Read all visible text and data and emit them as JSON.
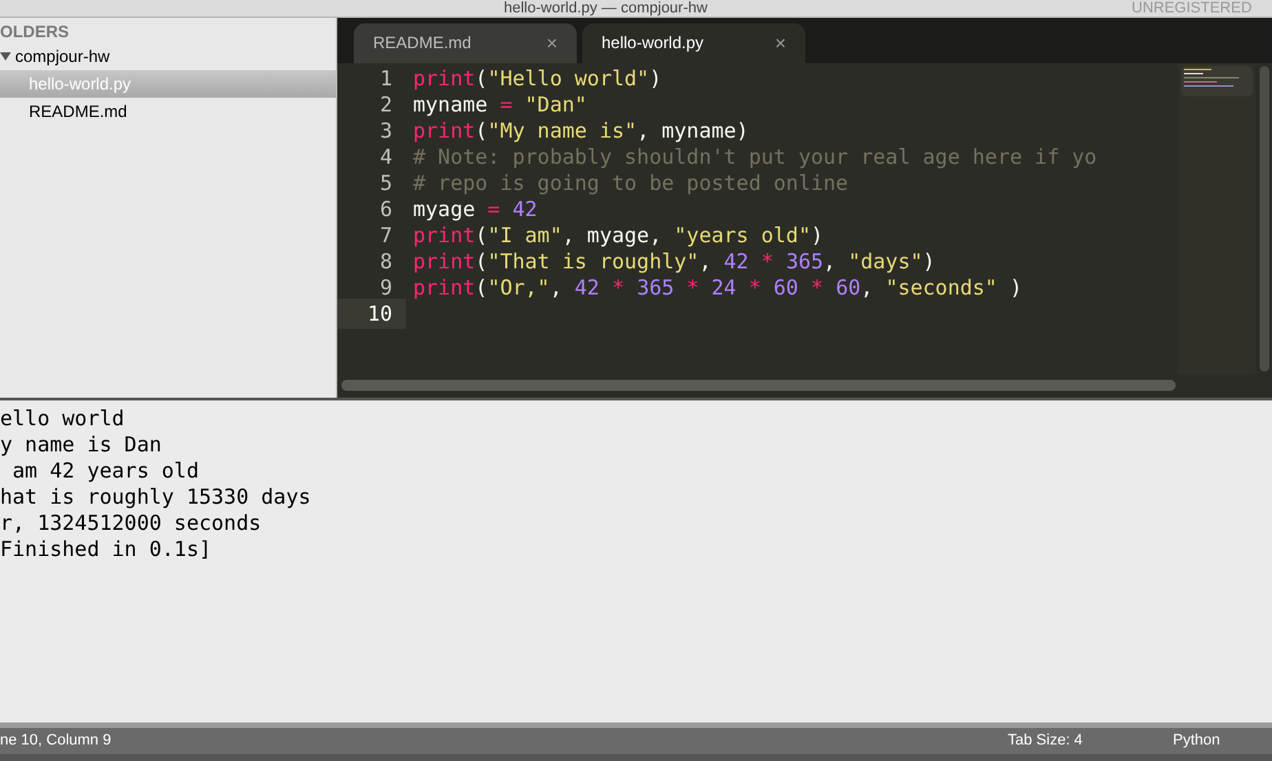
{
  "window": {
    "title": "hello-world.py — compjour-hw",
    "badge": "UNREGISTERED"
  },
  "sidebar": {
    "header": "OLDERS",
    "items": [
      {
        "label": "compjour-hw",
        "expanded": true,
        "selected": false,
        "children": [
          {
            "label": "hello-world.py",
            "selected": true
          },
          {
            "label": "README.md",
            "selected": false
          }
        ]
      }
    ]
  },
  "tabs": [
    {
      "label": "README.md",
      "close": "×",
      "selected": false
    },
    {
      "label": "hello-world.py",
      "close": "×",
      "selected": true
    }
  ],
  "editor": {
    "lines": [
      {
        "number": "1",
        "current": false,
        "tokens": [
          {
            "kind": "builtin",
            "text": "print"
          },
          {
            "kind": "plain",
            "text": "("
          },
          {
            "kind": "string",
            "text": "\"Hello world\""
          },
          {
            "kind": "plain",
            "text": ")"
          }
        ]
      },
      {
        "number": "2",
        "current": false,
        "tokens": [
          {
            "kind": "plain",
            "text": "myname"
          },
          {
            "kind": "operator",
            "text": " = "
          },
          {
            "kind": "string",
            "text": "\"Dan\""
          }
        ]
      },
      {
        "number": "3",
        "current": false,
        "tokens": [
          {
            "kind": "builtin",
            "text": "print"
          },
          {
            "kind": "plain",
            "text": "("
          },
          {
            "kind": "string",
            "text": "\"My name is\""
          },
          {
            "kind": "plain",
            "text": ", myname)"
          }
        ]
      },
      {
        "number": "4",
        "current": false,
        "tokens": [
          {
            "kind": "comment",
            "text": "# Note: probably shouldn't put your real age here if yo"
          }
        ]
      },
      {
        "number": "5",
        "current": false,
        "tokens": [
          {
            "kind": "comment",
            "text": "# repo is going to be posted online"
          }
        ]
      },
      {
        "number": "6",
        "current": false,
        "tokens": [
          {
            "kind": "plain",
            "text": "myage"
          },
          {
            "kind": "operator",
            "text": " = "
          },
          {
            "kind": "number",
            "text": "42"
          }
        ]
      },
      {
        "number": "7",
        "current": false,
        "tokens": [
          {
            "kind": "builtin",
            "text": "print"
          },
          {
            "kind": "plain",
            "text": "("
          },
          {
            "kind": "string",
            "text": "\"I am\""
          },
          {
            "kind": "plain",
            "text": ", myage, "
          },
          {
            "kind": "string",
            "text": "\"years old\""
          },
          {
            "kind": "plain",
            "text": ")"
          }
        ]
      },
      {
        "number": "8",
        "current": false,
        "tokens": [
          {
            "kind": "builtin",
            "text": "print"
          },
          {
            "kind": "plain",
            "text": "("
          },
          {
            "kind": "string",
            "text": "\"That is roughly\""
          },
          {
            "kind": "plain",
            "text": ", "
          },
          {
            "kind": "number",
            "text": "42"
          },
          {
            "kind": "operator",
            "text": " * "
          },
          {
            "kind": "number",
            "text": "365"
          },
          {
            "kind": "plain",
            "text": ", "
          },
          {
            "kind": "string",
            "text": "\"days\""
          },
          {
            "kind": "plain",
            "text": ")"
          }
        ]
      },
      {
        "number": "9",
        "current": false,
        "tokens": [
          {
            "kind": "builtin",
            "text": "print"
          },
          {
            "kind": "plain",
            "text": "("
          },
          {
            "kind": "string",
            "text": "\"Or,\""
          },
          {
            "kind": "plain",
            "text": ", "
          },
          {
            "kind": "number",
            "text": "42"
          },
          {
            "kind": "operator",
            "text": " * "
          },
          {
            "kind": "number",
            "text": "365"
          },
          {
            "kind": "operator",
            "text": " * "
          },
          {
            "kind": "number",
            "text": "24"
          },
          {
            "kind": "operator",
            "text": " * "
          },
          {
            "kind": "number",
            "text": "60"
          },
          {
            "kind": "operator",
            "text": " * "
          },
          {
            "kind": "number",
            "text": "60"
          },
          {
            "kind": "plain",
            "text": ", "
          },
          {
            "kind": "string",
            "text": "\"seconds\""
          },
          {
            "kind": "plain",
            "text": " )"
          }
        ]
      },
      {
        "number": "10",
        "current": true
      }
    ]
  },
  "output": {
    "lines": [
      "ello world",
      "y name is Dan",
      " am 42 years old",
      "hat is roughly 15330 days",
      "r, 1324512000 seconds",
      "Finished in 0.1s]"
    ]
  },
  "status_bar": {
    "position": "ne 10, Column 9",
    "tab_size": "Tab Size: 4",
    "syntax": "Python"
  }
}
